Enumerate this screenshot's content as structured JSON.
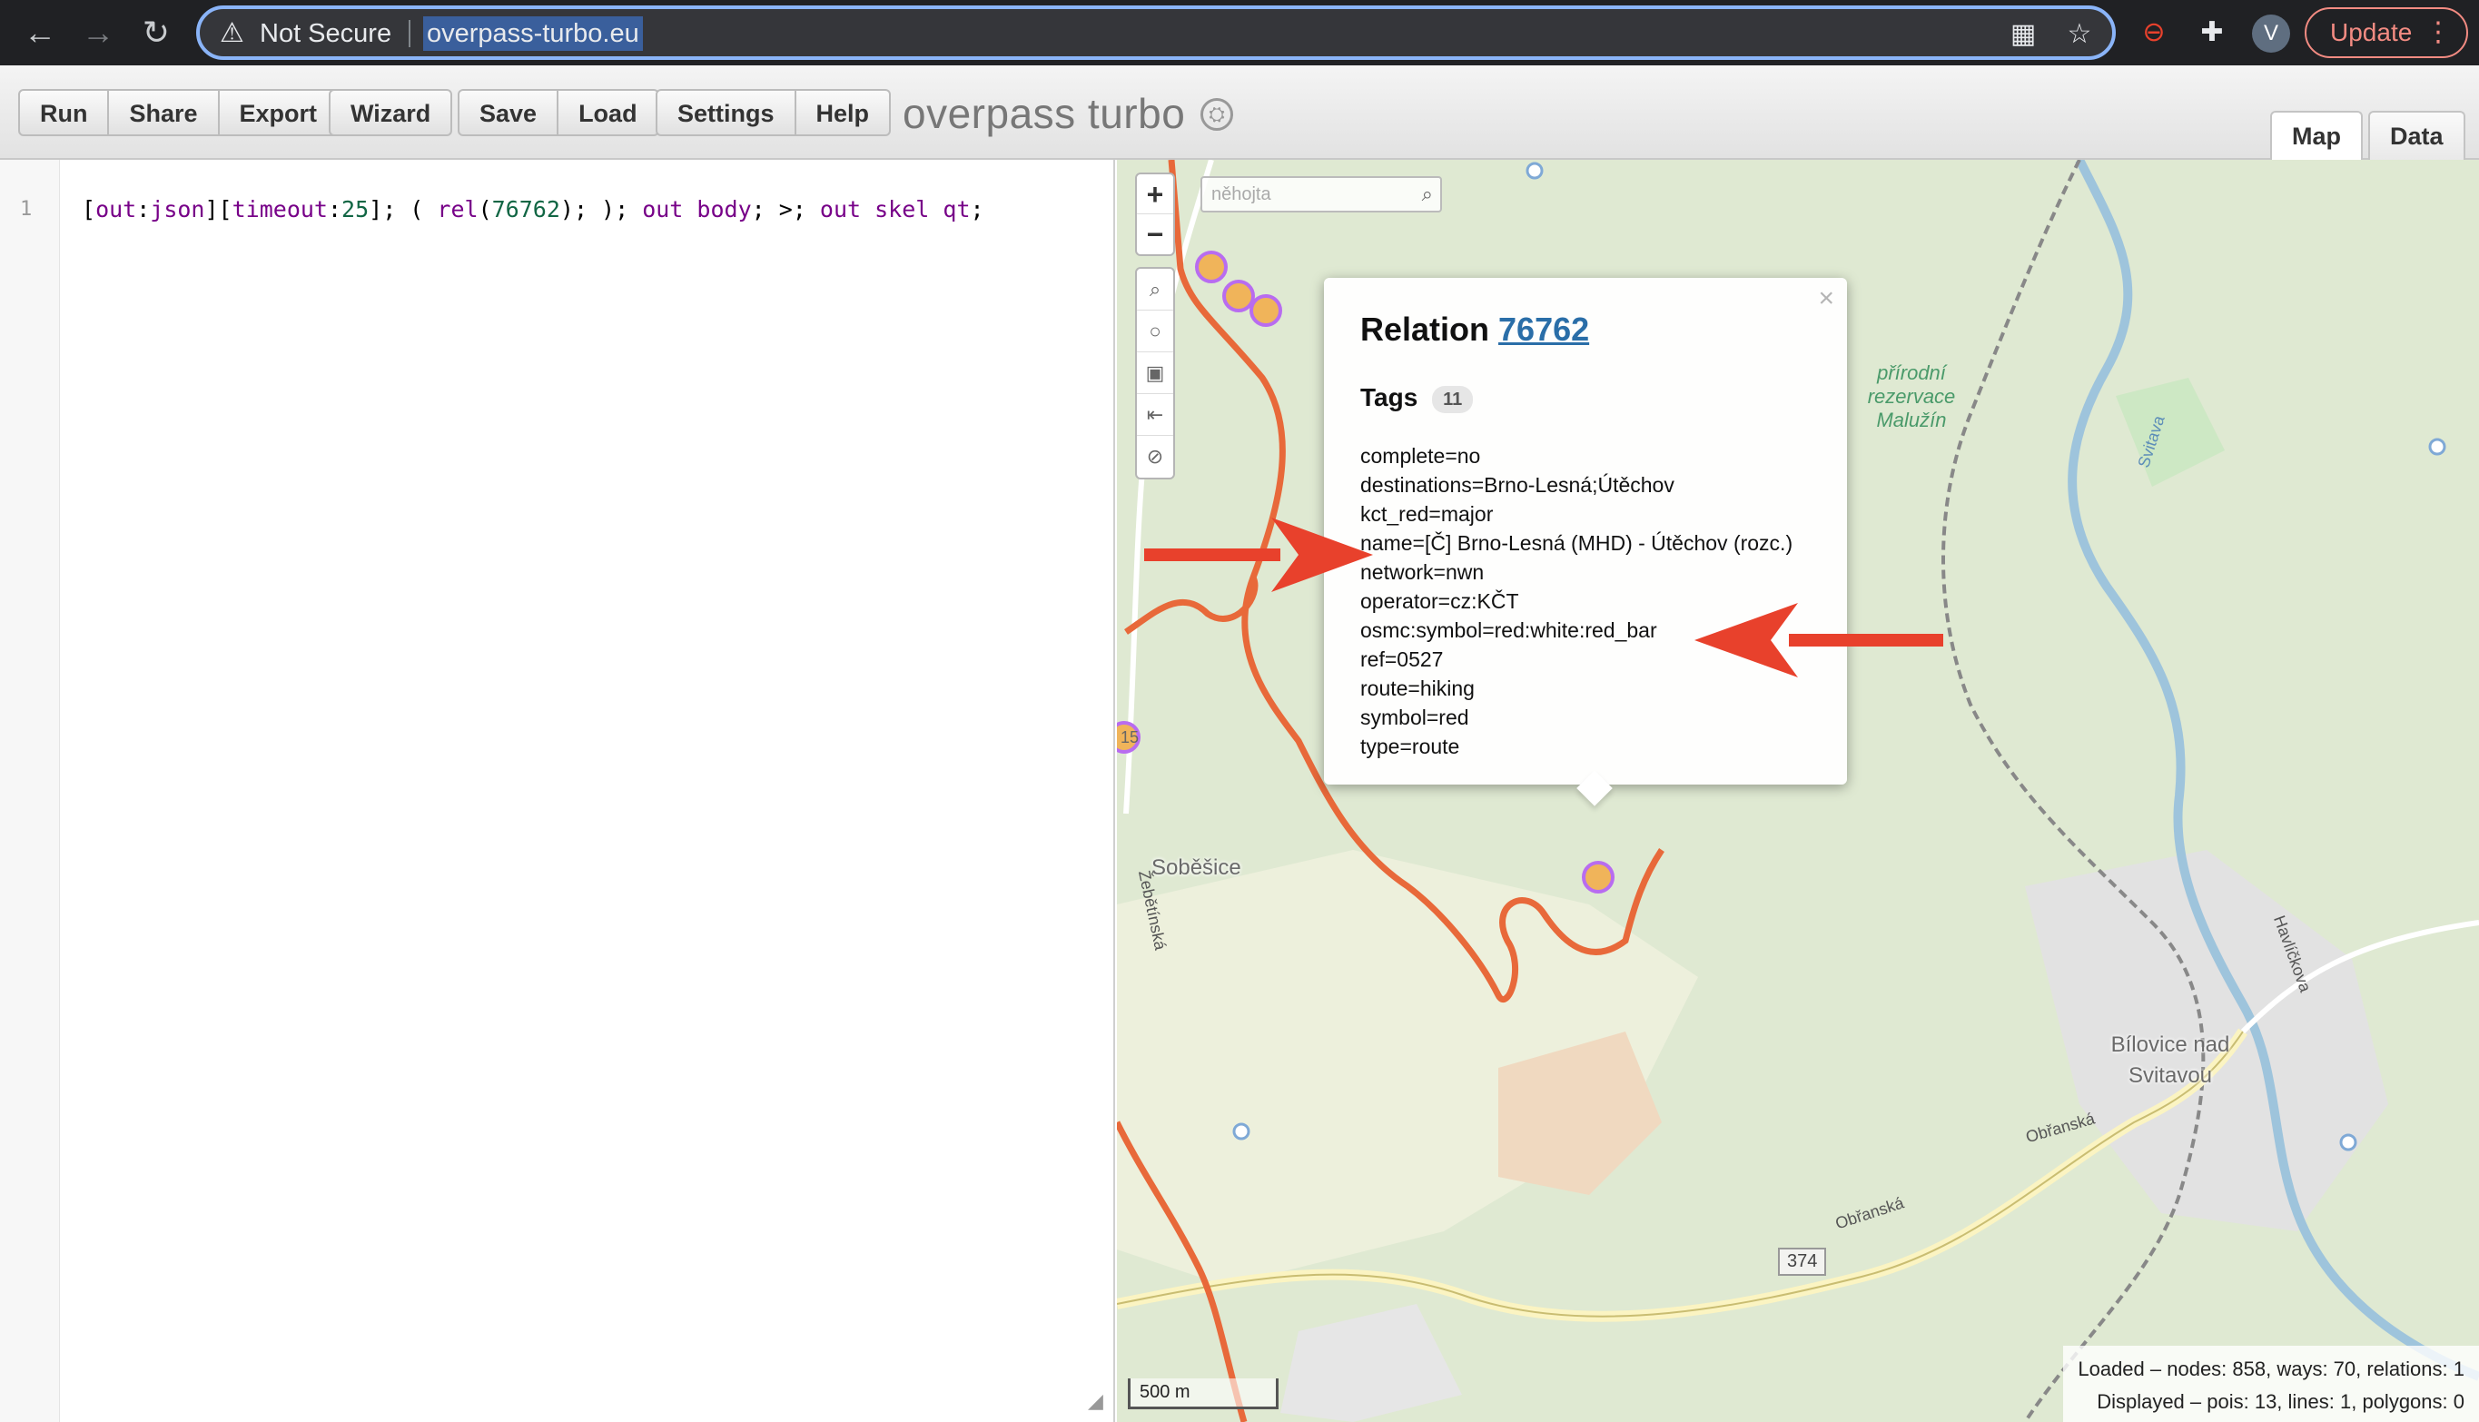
{
  "browser": {
    "security_label": "Not Secure",
    "url": "overpass-turbo.eu",
    "profile_initial": "V",
    "update_label": "Update"
  },
  "toolbar": {
    "run": "Run",
    "share": "Share",
    "export": "Export",
    "wizard": "Wizard",
    "save": "Save",
    "load": "Load",
    "settings": "Settings",
    "help": "Help",
    "title": "overpass turbo"
  },
  "tabs": {
    "map": "Map",
    "data": "Data"
  },
  "editor": {
    "line_number": "1",
    "code": "[out:json][timeout:25]; ( rel(76762); ); out body; >; out skel qt;"
  },
  "map": {
    "search_placeholder": "něhojta",
    "places": {
      "sobesice": "Soběšice",
      "bilovice": "Bílovice nad Svitavou",
      "reserve": "přírodní rezervace Malužín",
      "zebetinska": "Žebětínská",
      "obranska1": "Obřanská",
      "obranska2": "Obřanská",
      "svitava": "Svitava",
      "havlickova": "Havlíčkova",
      "route_num": "374",
      "edge_num": "15"
    }
  },
  "popup": {
    "title_prefix": "Relation",
    "relation_id": "76762",
    "tags_label": "Tags",
    "tags_count": "11",
    "tags": [
      "complete=no",
      "destinations=Brno-Lesná;Útěchov",
      "kct_red=major",
      "name=[Č] Brno-Lesná (MHD) - Útěchov (rozc.)",
      "network=nwn",
      "operator=cz:KČT",
      "osmc:symbol=red:white:red_bar",
      "ref=0527",
      "route=hiking",
      "symbol=red",
      "type=route"
    ]
  },
  "status": {
    "scale": "500 m",
    "loaded": "Loaded – nodes: 858, ways: 70, relations: 1",
    "displayed": "Displayed – pois: 13, lines: 1, polygons: 0"
  },
  "colors": {
    "route": "#e8693a",
    "highlight": "#b86cf0",
    "arrow": "#e8412c",
    "river": "#9ec4dc"
  }
}
